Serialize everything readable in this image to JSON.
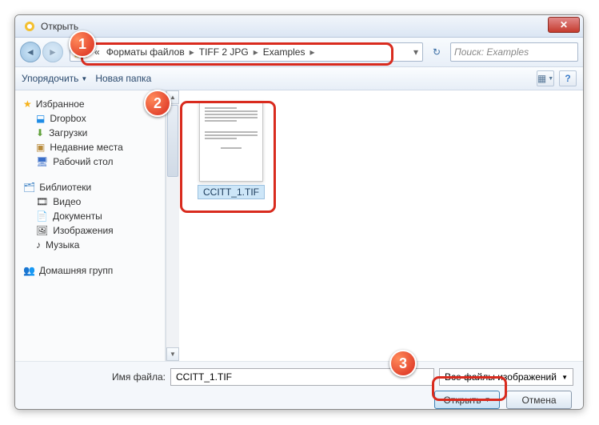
{
  "window": {
    "title": "Открыть"
  },
  "breadcrumb": {
    "prefix": "«",
    "seg1": "Форматы файлов",
    "seg2": "TIFF 2 JPG",
    "seg3": "Examples"
  },
  "search": {
    "placeholder": "Поиск: Examples"
  },
  "toolbar": {
    "organize": "Упорядочить",
    "newfolder": "Новая папка"
  },
  "sidebar": {
    "favorites": "Избранное",
    "dropbox": "Dropbox",
    "downloads": "Загрузки",
    "recent": "Недавние места",
    "desktop": "Рабочий стол",
    "libraries": "Библиотеки",
    "videos": "Видео",
    "documents": "Документы",
    "pictures": "Изображения",
    "music": "Музыка",
    "homegroup": "Домашняя групп"
  },
  "file": {
    "name": "CCITT_1.TIF"
  },
  "bottom": {
    "filename_label": "Имя файла:",
    "filename_value": "CCITT_1.TIF",
    "filetype": "Все файлы изображений",
    "open": "Открыть",
    "cancel": "Отмена"
  },
  "annotations": {
    "b1": "1",
    "b2": "2",
    "b3": "3"
  }
}
